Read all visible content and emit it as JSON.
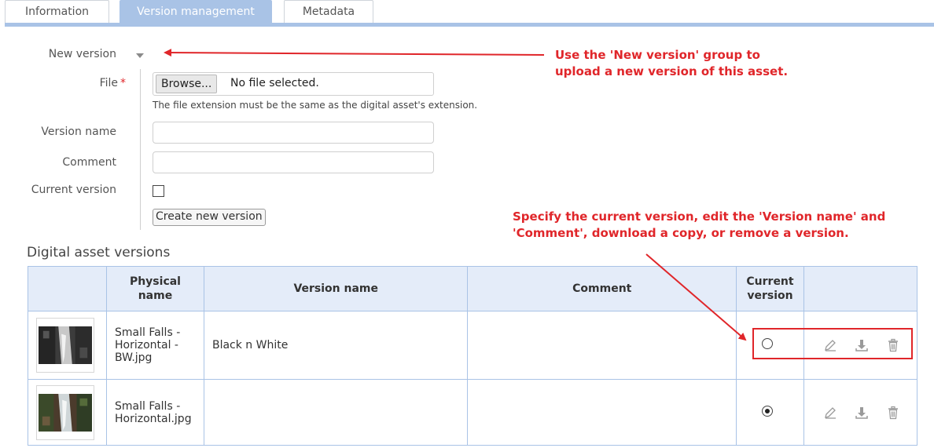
{
  "tabs": [
    {
      "label": "Information",
      "active": false
    },
    {
      "label": "Version management",
      "active": true
    },
    {
      "label": "Metadata",
      "active": false
    }
  ],
  "form": {
    "group_label": "New version",
    "file_label": "File",
    "file_required_marker": "*",
    "browse_label": "Browse...",
    "no_file_text": "No file selected.",
    "file_hint": "The file extension must be the same as the digital asset's extension.",
    "version_name_label": "Version name",
    "version_name_value": "",
    "comment_label": "Comment",
    "comment_value": "",
    "current_version_label": "Current version",
    "current_version_checked": false,
    "create_button": "Create new version"
  },
  "annotations": {
    "note1": "Use the 'New version' group to upload a new version of this asset.",
    "note2": "Specify the current version, edit the 'Version name' and 'Comment', download a copy, or remove a version."
  },
  "versions": {
    "title": "Digital asset versions",
    "columns": [
      "",
      "Physical name",
      "Version name",
      "Comment",
      "Current version",
      ""
    ],
    "rows": [
      {
        "physical_name": "Small Falls - Horizontal - BW.jpg",
        "version_name": "Black n White",
        "comment": "",
        "current": false
      },
      {
        "physical_name": "Small Falls - Horizontal.jpg",
        "version_name": "",
        "comment": "",
        "current": true
      }
    ]
  },
  "colors": {
    "accent": "#a9c3e6",
    "header_bg": "#e4ecf9",
    "annotation_red": "#e0262a"
  },
  "icons": [
    "pencil-icon",
    "download-icon",
    "trash-icon",
    "caret-down-icon"
  ]
}
